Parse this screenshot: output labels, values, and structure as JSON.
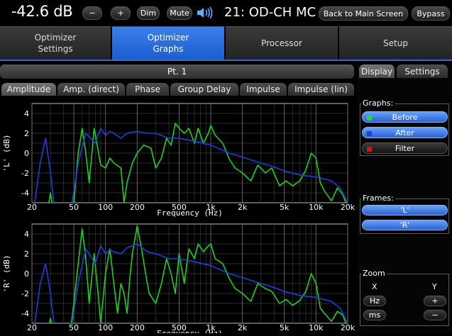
{
  "header": {
    "volume": "-42.6 dB",
    "vol_down": "−",
    "vol_up": "+",
    "dim": "Dim",
    "mute": "Mute",
    "signal": "21: OD-CH MC",
    "back": "Back to Main Screen",
    "bypass": "Bypass"
  },
  "main_tabs": [
    {
      "line1": "Optimizer",
      "line2": "Settings"
    },
    {
      "line1": "Optimizer",
      "line2": "Graphs"
    },
    {
      "line1": "Processor",
      "line2": ""
    },
    {
      "line1": "Setup",
      "line2": ""
    }
  ],
  "point_label": "Pt. 1",
  "graph_tabs": [
    "Amplitude",
    "Amp. (direct)",
    "Phase",
    "Group Delay",
    "Impulse",
    "Impulse (lin)"
  ],
  "side_tabs": [
    "Display",
    "Settings"
  ],
  "graphs_group": {
    "title": "Graphs:",
    "items": [
      "Before",
      "After",
      "Filter"
    ]
  },
  "frames_group": {
    "title": "Frames:",
    "items": [
      "'L'",
      "'R'"
    ]
  },
  "zoom_group": {
    "title": "Zoom",
    "x_label": "X",
    "y_label": "Y",
    "hz": "Hz",
    "ms": "ms",
    "plus": "+",
    "minus": "−"
  },
  "colors": {
    "before": "#22cc22",
    "after": "#1f3fd8",
    "filter": "#cc1111",
    "accent": "#2a62d6"
  },
  "chart_data": [
    {
      "type": "line",
      "ylabel": "'L' (dB)",
      "xlabel": "Frequency (Hz)",
      "x_scale": "log",
      "xlim": [
        20,
        20000
      ],
      "ylim": [
        -5,
        5
      ],
      "x_ticks": [
        20,
        50,
        100,
        200,
        500,
        1000,
        2000,
        5000,
        10000,
        20000
      ],
      "x_tick_labels": [
        "20",
        "50",
        "100",
        "200",
        "500",
        "1k",
        "2k",
        "5k",
        "10k",
        "20k"
      ],
      "y_ticks": [
        4,
        2,
        0,
        -2,
        -4
      ],
      "grid": true,
      "series": [
        {
          "color": "#22cc22",
          "x": [
            20,
            27,
            30,
            33,
            38,
            45,
            50,
            55,
            60,
            65,
            70,
            78,
            90,
            100,
            110,
            120,
            140,
            150,
            160,
            180,
            200,
            230,
            270,
            300,
            340,
            380,
            420,
            460,
            500,
            560,
            620,
            700,
            760,
            850,
            950,
            1000,
            1100,
            1300,
            1500,
            1700,
            2000,
            2400,
            2800,
            3300,
            3800,
            4500,
            5200,
            6000,
            7000,
            8000,
            9000,
            10000,
            11000,
            12000,
            14000,
            16000,
            18000,
            20000
          ],
          "y": [
            -7,
            -7,
            -4,
            -7,
            -7,
            -7,
            -5,
            0,
            2.5,
            0,
            -3,
            2.5,
            -1.2,
            -1.5,
            -0.5,
            -1,
            -1.5,
            -5,
            -3,
            -1,
            0,
            0.8,
            0.5,
            -1.5,
            -0.5,
            1.5,
            0.8,
            3,
            2.5,
            2,
            2.5,
            1,
            2.5,
            1,
            2,
            2.8,
            1.8,
            1,
            -0.6,
            -1.5,
            -2,
            -2.8,
            -1.2,
            -2,
            -1.5,
            -3.3,
            -2.8,
            -3.3,
            -2.8,
            -1.7,
            0,
            -0.5,
            -3,
            -3.8,
            -4.8,
            -3.5,
            -4.2,
            -5.5
          ]
        },
        {
          "color": "#1f3fd8",
          "x": [
            20,
            24,
            27,
            30,
            34,
            40,
            45,
            55,
            65,
            80,
            90,
            100,
            110,
            120,
            140,
            160,
            200,
            250,
            300,
            400,
            500,
            700,
            1000,
            1500,
            2000,
            3000,
            4000,
            5000,
            7000,
            10000,
            14000,
            17000,
            20000
          ],
          "y": [
            -7,
            -1,
            1.5,
            -2,
            -7,
            -7,
            -7,
            -1,
            2,
            1,
            2.5,
            1.8,
            2.2,
            2,
            1.5,
            2,
            2.2,
            2,
            2,
            1.5,
            1.5,
            1.2,
            0.8,
            0,
            -0.4,
            -1,
            -1.4,
            -1.8,
            -2.2,
            -2.4,
            -2.8,
            -3.5,
            -5
          ]
        }
      ]
    },
    {
      "type": "line",
      "ylabel": "'R' (dB)",
      "xlabel": "Frequency (Hz)",
      "x_scale": "log",
      "xlim": [
        20,
        20000
      ],
      "ylim": [
        -5,
        5
      ],
      "x_ticks": [
        20,
        50,
        100,
        200,
        500,
        1000,
        2000,
        5000,
        10000,
        20000
      ],
      "x_tick_labels": [
        "20",
        "50",
        "100",
        "200",
        "500",
        "1k",
        "2k",
        "5k",
        "10k",
        "20k"
      ],
      "y_ticks": [
        4,
        2,
        0,
        -2,
        -4
      ],
      "grid": true,
      "series": [
        {
          "color": "#22cc22",
          "x": [
            20,
            27,
            30,
            33,
            38,
            45,
            50,
            55,
            60,
            65,
            70,
            78,
            85,
            90,
            100,
            110,
            120,
            130,
            140,
            150,
            160,
            170,
            180,
            200,
            220,
            240,
            260,
            300,
            340,
            380,
            420,
            460,
            500,
            560,
            620,
            700,
            760,
            850,
            950,
            1000,
            1100,
            1300,
            1500,
            1700,
            2000,
            2400,
            2800,
            3300,
            3800,
            4500,
            5200,
            6000,
            7000,
            8000,
            9000,
            10000,
            11000,
            12000,
            14000,
            16000,
            18000,
            20000
          ],
          "y": [
            -7,
            -7,
            -4.5,
            -7,
            -7,
            -7,
            -3,
            1,
            4.5,
            1.5,
            -3,
            2,
            -2,
            -5,
            0,
            2.5,
            -1,
            -4,
            -1,
            -2,
            -4,
            -0.5,
            2,
            4.8,
            2.5,
            0,
            -2,
            -3,
            -1,
            1.5,
            0,
            -2,
            2,
            -1,
            2.5,
            1.5,
            3,
            2.2,
            2.8,
            3,
            1.5,
            1,
            -0.5,
            -1.5,
            -2,
            -2.8,
            -1,
            -1.5,
            -1.8,
            -3,
            -2.6,
            -3.2,
            -2.7,
            -1.8,
            0,
            -1,
            -3.5,
            -4,
            -4.8,
            -3.8,
            -4.2,
            -5.5
          ]
        },
        {
          "color": "#1f3fd8",
          "x": [
            20,
            24,
            27,
            30,
            34,
            40,
            45,
            55,
            65,
            80,
            90,
            100,
            110,
            120,
            140,
            160,
            200,
            250,
            300,
            400,
            500,
            700,
            1000,
            1500,
            2000,
            3000,
            4000,
            5000,
            7000,
            10000,
            14000,
            17000,
            20000
          ],
          "y": [
            -7,
            -1,
            1,
            -2,
            -7,
            -7,
            -7,
            -1,
            2.5,
            1,
            2.8,
            2,
            2.4,
            2.2,
            2,
            2.6,
            3,
            2.2,
            2,
            1.5,
            1.5,
            1.2,
            0.8,
            0,
            -0.4,
            -1,
            -1.4,
            -1.8,
            -2.2,
            -2.4,
            -2.8,
            -3.5,
            -5
          ]
        }
      ]
    }
  ]
}
